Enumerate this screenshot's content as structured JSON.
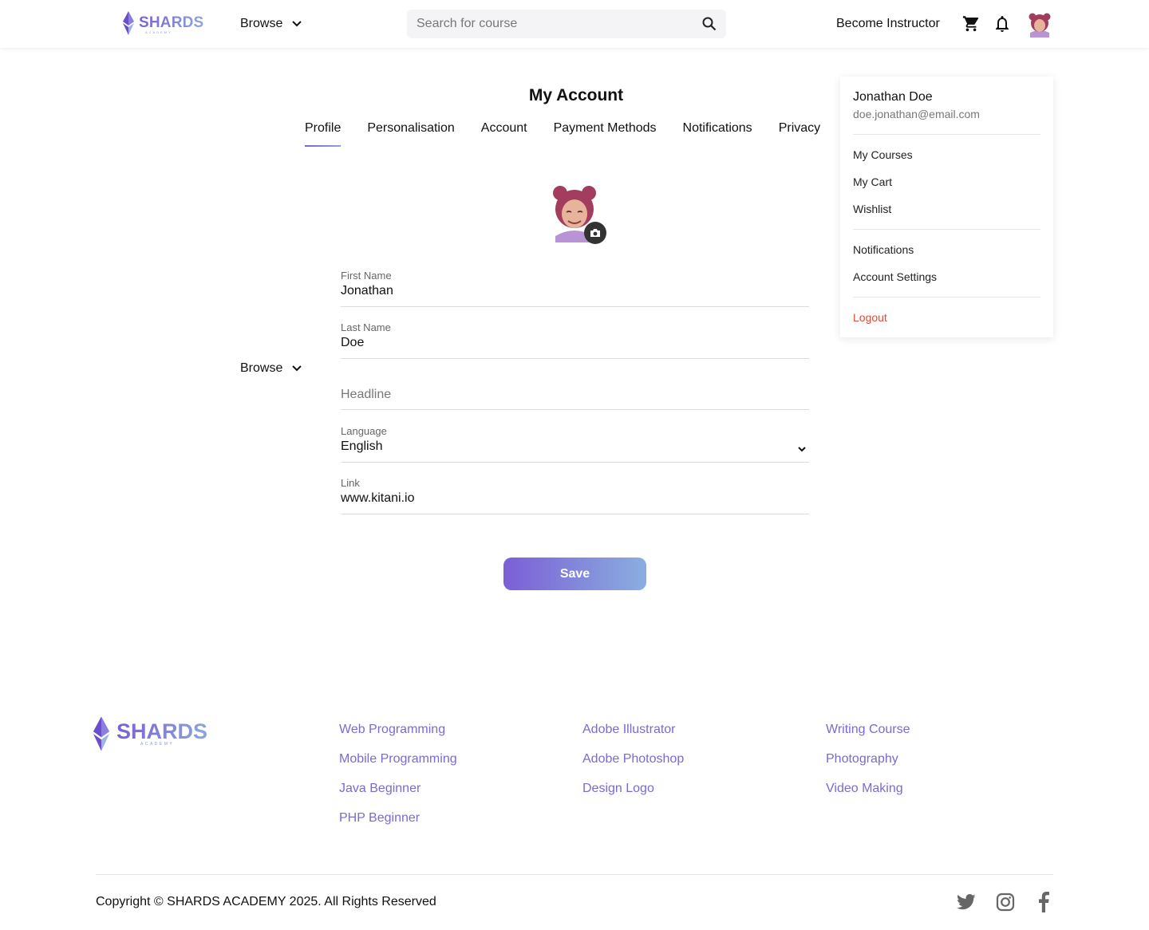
{
  "brand": {
    "name": "SHARDS",
    "sub": "ACADEMY"
  },
  "header": {
    "browse_label": "Browse",
    "search_placeholder": "Search for course",
    "become_instructor": "Become Instructor"
  },
  "page": {
    "title": "My Account",
    "tabs": [
      {
        "label": "Profile",
        "active": true
      },
      {
        "label": "Personalisation",
        "active": false
      },
      {
        "label": "Account",
        "active": false
      },
      {
        "label": "Payment Methods",
        "active": false
      },
      {
        "label": "Notifications",
        "active": false
      },
      {
        "label": "Privacy",
        "active": false
      }
    ],
    "side_browse_label": "Browse"
  },
  "form": {
    "first_name": {
      "label": "First Name",
      "value": "Jonathan"
    },
    "last_name": {
      "label": "Last Name",
      "value": "Doe"
    },
    "headline": {
      "placeholder": "Headline"
    },
    "language": {
      "label": "Language",
      "value": "English"
    },
    "link": {
      "label": "Link",
      "value": "www.kitani.io"
    },
    "save_label": "Save"
  },
  "user_menu": {
    "name": "Jonathan Doe",
    "email": "doe.jonathan@email.com",
    "group1": [
      "My Courses",
      "My Cart",
      "Wishlist"
    ],
    "group2": [
      "Notifications",
      "Account Settings"
    ],
    "logout": "Logout"
  },
  "footer": {
    "columns": [
      [
        "Web Programming",
        "Mobile Programming",
        "Java Beginner",
        "PHP Beginner"
      ],
      [
        "Adobe Illustrator",
        "Adobe Photoshop",
        "Design Logo"
      ],
      [
        "Writing Course",
        "Photography",
        "Video Making"
      ]
    ],
    "copyright": "Copyright © SHARDS ACADEMY 2025. All Rights Reserved",
    "social": [
      "twitter-icon",
      "instagram-icon",
      "facebook-icon"
    ]
  },
  "colors": {
    "accent_start": "#7b5fd6",
    "accent_end": "#8aaee0",
    "logout": "#e04a3a",
    "footer_link": "#7b6ad2"
  }
}
